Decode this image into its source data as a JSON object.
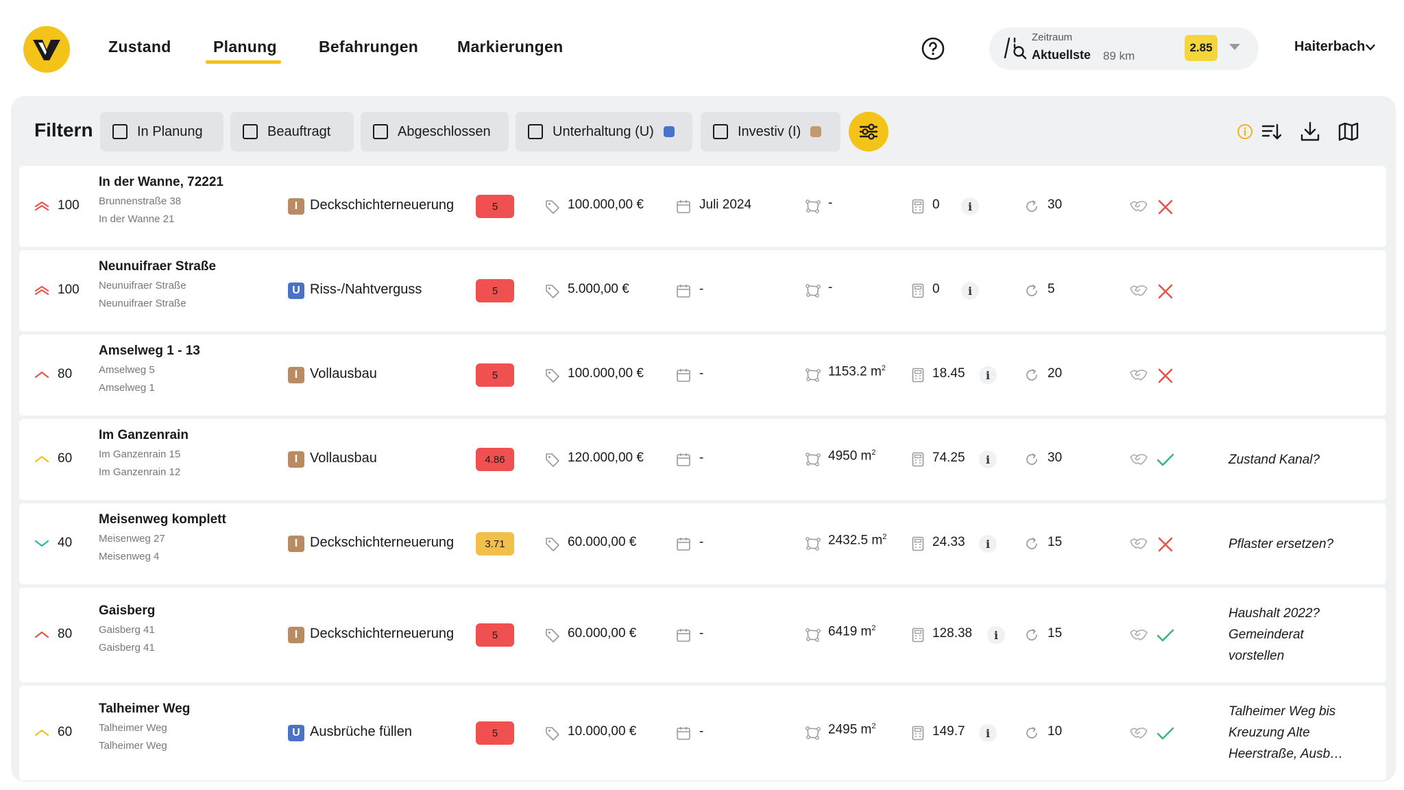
{
  "nav": {
    "items": [
      "Zustand",
      "Planung",
      "Befahrungen",
      "Markierungen"
    ],
    "active": "Planung"
  },
  "zeitraum": {
    "label": "Zeitraum",
    "value": "Aktuellste",
    "km": "89 km",
    "badge": "2.85"
  },
  "town": "Haiterbach",
  "filter": {
    "title": "Filtern",
    "chips": [
      {
        "label": "In Planung",
        "dot": null
      },
      {
        "label": "Beauftragt",
        "dot": null
      },
      {
        "label": "Abgeschlossen",
        "dot": null
      },
      {
        "label": "Unterhaltung (U)",
        "dot": "#4a72c8"
      },
      {
        "label": "Investiv (I)",
        "dot": "#c19a72"
      }
    ]
  },
  "colors": {
    "accent": "#f4c31a",
    "type_I": "#b98b63",
    "type_U": "#4a72c8",
    "grade_red": "#f05050",
    "grade_orange": "#f2c04a",
    "prio_red": "#e8534a",
    "prio_yellow": "#f2c026",
    "prio_teal": "#2bb6a6",
    "check_green": "#3bb873",
    "cross_red": "#e8534a"
  },
  "rows": [
    {
      "prio_icon": "double-chevron-up-icon",
      "prio": "100",
      "title": "In der Wanne, 72221",
      "sub1": "Brunnenstraße 38",
      "sub2": "In der Wanne 21",
      "type": "I",
      "measure": "Deckschichterneuerung",
      "grade": "5",
      "grade_color": "red",
      "cost": "100.000,00 €",
      "date": "Juli 2024",
      "area": "-",
      "area_unit": "",
      "calc": "0",
      "cycle": "30",
      "status": "cross",
      "note": ""
    },
    {
      "prio_icon": "double-chevron-up-icon",
      "prio": "100",
      "title": "Neunuifraer Straße",
      "sub1": "Neunuifraer Straße",
      "sub2": "Neunuifraer Straße",
      "type": "U",
      "measure": "Riss-/Nahtverguss",
      "grade": "5",
      "grade_color": "red",
      "cost": "5.000,00 €",
      "date": "-",
      "area": "-",
      "area_unit": "",
      "calc": "0",
      "cycle": "5",
      "status": "cross",
      "note": ""
    },
    {
      "prio_icon": "chevron-up-icon",
      "prio": "80",
      "title": "Amselweg 1 - 13",
      "sub1": "Amselweg 5",
      "sub2": "Amselweg 1",
      "type": "I",
      "measure": "Vollausbau",
      "grade": "5",
      "grade_color": "red",
      "cost": "100.000,00 €",
      "date": "-",
      "area": "1153.2 m",
      "area_unit": "2",
      "calc": "18.45",
      "cycle": "20",
      "status": "cross",
      "note": ""
    },
    {
      "prio_icon": "chevron-up-icon",
      "prio": "60",
      "title": "Im Ganzenrain",
      "sub1": "Im Ganzenrain 15",
      "sub2": "Im Ganzenrain 12",
      "type": "I",
      "measure": "Vollausbau",
      "grade": "4.86",
      "grade_color": "red",
      "cost": "120.000,00 €",
      "date": "-",
      "area": "4950 m",
      "area_unit": "2",
      "calc": "74.25",
      "cycle": "30",
      "status": "check",
      "note": "Zustand Kanal?"
    },
    {
      "prio_icon": "chevron-down-icon",
      "prio": "40",
      "title": "Meisenweg komplett",
      "sub1": "Meisenweg 27",
      "sub2": "Meisenweg 4",
      "type": "I",
      "measure": "Deckschichterneuerung",
      "grade": "3.71",
      "grade_color": "orange",
      "cost": "60.000,00 €",
      "date": "-",
      "area": "2432.5 m",
      "area_unit": "2",
      "calc": "24.33",
      "cycle": "15",
      "status": "cross",
      "note": "Pflaster ersetzen?"
    },
    {
      "prio_icon": "chevron-up-icon",
      "prio": "80",
      "title": "Gaisberg",
      "sub1": "Gaisberg 41",
      "sub2": "Gaisberg 41",
      "type": "I",
      "measure": "Deckschichterneuerung",
      "grade": "5",
      "grade_color": "red",
      "cost": "60.000,00 €",
      "date": "-",
      "area": "6419 m",
      "area_unit": "2",
      "calc": "128.38",
      "cycle": "15",
      "status": "check",
      "note": "Haushalt 2022? Gemeinderat vorstellen"
    },
    {
      "prio_icon": "chevron-up-icon",
      "prio": "60",
      "title": "Talheimer Weg",
      "sub1": "Talheimer Weg",
      "sub2": "Talheimer Weg",
      "type": "U",
      "measure": "Ausbrüche füllen",
      "grade": "5",
      "grade_color": "red",
      "cost": "10.000,00 €",
      "date": "-",
      "area": "2495 m",
      "area_unit": "2",
      "calc": "149.7",
      "cycle": "10",
      "status": "check",
      "note": "Talheimer Weg bis Kreuzung Alte Heerstraße, Ausb…"
    }
  ]
}
